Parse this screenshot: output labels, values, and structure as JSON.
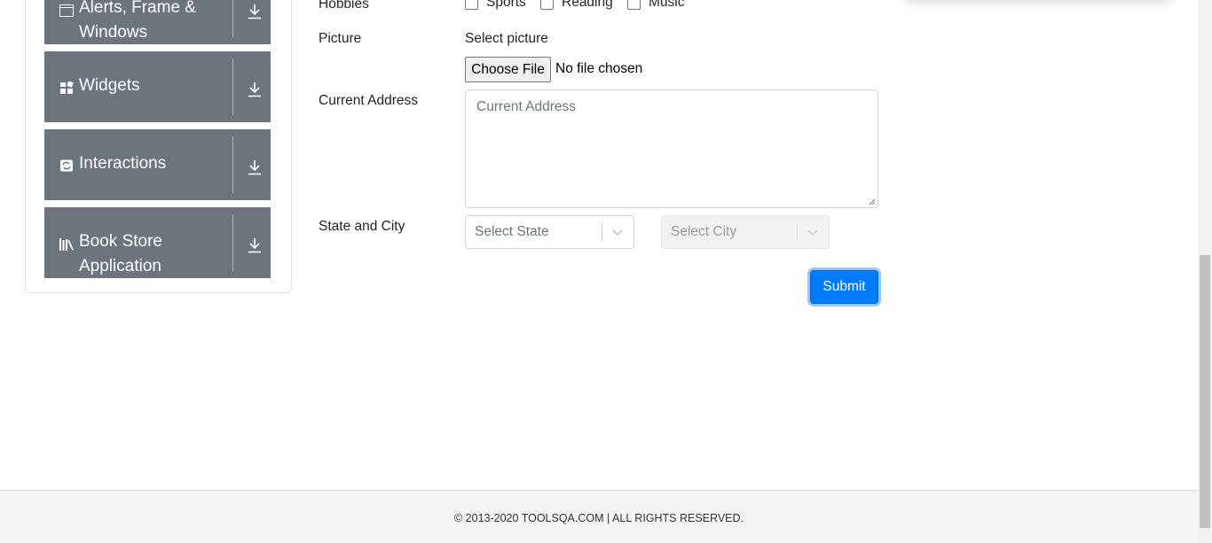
{
  "sidebar": {
    "groups": [
      {
        "label": "Alerts, Frame & Windows",
        "icon": "window-icon"
      },
      {
        "label": "Widgets",
        "icon": "widgets-icon"
      },
      {
        "label": "Interactions",
        "icon": "interactions-icon"
      },
      {
        "label": "Book Store Application",
        "icon": "book-icon"
      }
    ]
  },
  "form": {
    "hobbies_label": "Hobbies",
    "hobbies": [
      "Sports",
      "Reading",
      "Music"
    ],
    "picture_label": "Picture",
    "picture_select_label": "Select picture",
    "choose_file_label": "Choose File",
    "no_file_text": "No file chosen",
    "address_label": "Current Address",
    "address_placeholder": "Current Address",
    "state_city_label": "State and City",
    "state_placeholder": "Select State",
    "city_placeholder": "Select City",
    "submit_label": "Submit"
  },
  "footer": {
    "text": "© 2013-2020 TOOLSQA.COM | ALL RIGHTS RESERVED."
  },
  "colors": {
    "accordion_bg": "#6c757d",
    "primary": "#007bff"
  }
}
